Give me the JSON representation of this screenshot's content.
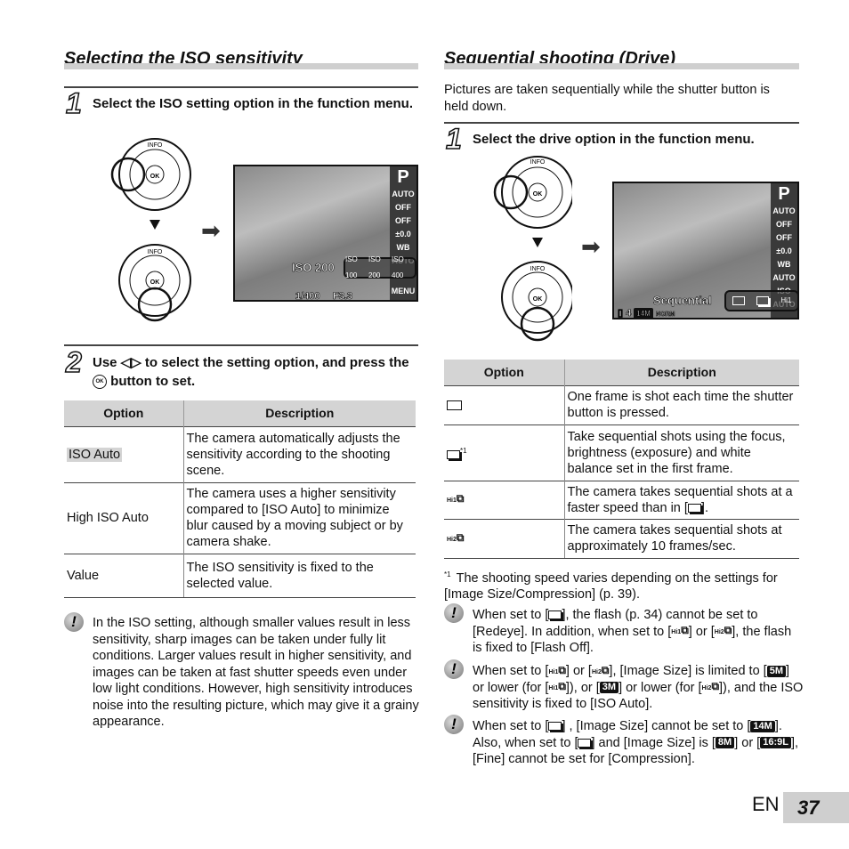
{
  "left": {
    "title": "Selecting the ISO sensitivity",
    "step1": {
      "num": "1",
      "text": "Select the ISO setting option in the function menu."
    },
    "screen": {
      "mode": "P",
      "side": [
        "AUTO",
        "OFF",
        "OFF",
        "±0.0",
        "WB AUTO"
      ],
      "selected": "ISO 200",
      "options": [
        "ISO 100",
        "ISO 200",
        "ISO 400"
      ],
      "shutter": "1/400",
      "aperture": "F3.3",
      "menu": "MENU"
    },
    "dial": {
      "info": "INFO",
      "ok": "OK"
    },
    "step2": {
      "num": "2",
      "text_a": "Use ◁▷ to select the setting option, and press the",
      "ok": "OK",
      "text_b": "button to set."
    },
    "table": {
      "headers": [
        "Option",
        "Description"
      ],
      "rows": [
        {
          "option": "ISO Auto",
          "desc": "The camera automatically adjusts the sensitivity according to the shooting scene."
        },
        {
          "option": "High ISO Auto",
          "desc": "The camera uses a higher sensitivity compared to [ISO Auto] to minimize blur caused by a moving subject or by camera shake."
        },
        {
          "option": "Value",
          "desc": "The ISO sensitivity is fixed to the selected value."
        }
      ]
    },
    "note": "In the ISO setting, although smaller values result in less sensitivity, sharp images can be taken under fully lit conditions. Larger values result in higher sensitivity, and images can be taken at fast shutter speeds even under low light conditions. However, high sensitivity introduces noise into the resulting picture, which may give it a grainy appearance."
  },
  "right": {
    "title": "Sequential shooting (Drive)",
    "intro": "Pictures are taken sequentially while the shutter button is held down.",
    "step1": {
      "num": "1",
      "text": "Select the drive option in the function menu."
    },
    "screen": {
      "mode": "P",
      "side": [
        "AUTO",
        "OFF",
        "OFF",
        "±0.0",
        "WB AUTO",
        "ISO AUTO"
      ],
      "selected": "Sequential",
      "count": "4",
      "size": "14M",
      "quality": "NORM"
    },
    "table": {
      "headers": [
        "Option",
        "Description"
      ],
      "rows": [
        {
          "icon": "single",
          "sup": "",
          "desc": "One frame is shot each time the shutter button is pressed."
        },
        {
          "icon": "seq",
          "sup": "*1",
          "desc": "Take sequential shots using the focus, brightness (exposure) and white balance set in the first frame."
        },
        {
          "icon": "hi1",
          "sup": "",
          "desc": [
            {
              "t": "The camera takes sequential shots at a faster speed than in ["
            },
            {
              "i": "seq"
            },
            {
              "t": "]."
            }
          ]
        },
        {
          "icon": "hi2",
          "sup": "",
          "desc": "The camera takes sequential shots at approximately 10 frames/sec."
        }
      ]
    },
    "footnote": {
      "mark": "*1",
      "text": "The shooting speed varies depending on the settings for [Image Size/Compression] (p. 39)."
    },
    "notes": [
      [
        {
          "t": "When set to ["
        },
        {
          "i": "seq"
        },
        {
          "t": "], the flash (p. 34) cannot be set to [Redeye]. In addition, when set to ["
        },
        {
          "i": "hi1"
        },
        {
          "t": "] or ["
        },
        {
          "i": "hi2"
        },
        {
          "t": "], the flash is fixed to [Flash Off]."
        }
      ],
      [
        {
          "t": "When set to ["
        },
        {
          "i": "hi1"
        },
        {
          "t": "] or ["
        },
        {
          "i": "hi2"
        },
        {
          "t": "], [Image Size] is limited to ["
        },
        {
          "b": "5M"
        },
        {
          "t": "] or lower (for ["
        },
        {
          "i": "hi1"
        },
        {
          "t": "]), or ["
        },
        {
          "b": "3M"
        },
        {
          "t": "] or lower (for ["
        },
        {
          "i": "hi2"
        },
        {
          "t": "]), and the ISO sensitivity is fixed to [ISO Auto]."
        }
      ],
      [
        {
          "t": "When set to ["
        },
        {
          "i": "seq"
        },
        {
          "t": "] , [Image Size] cannot be set to ["
        },
        {
          "b": "14M"
        },
        {
          "t": "]. Also, when set to ["
        },
        {
          "i": "seq"
        },
        {
          "t": "] and [Image Size] is ["
        },
        {
          "b": "8M"
        },
        {
          "t": "] or ["
        },
        {
          "b": "16:9L"
        },
        {
          "t": "], [Fine] cannot be set for [Compression]."
        }
      ]
    ]
  },
  "footer": {
    "lang": "EN",
    "page": "37"
  }
}
